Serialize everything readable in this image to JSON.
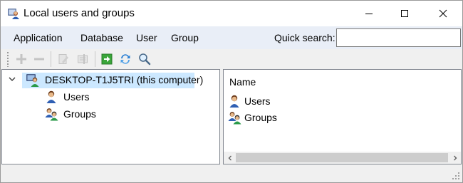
{
  "window": {
    "title": "Local users and groups"
  },
  "menu": {
    "items": [
      "Application",
      "Database",
      "User",
      "Group"
    ]
  },
  "search": {
    "label": "Quick search:",
    "value": "",
    "placeholder": ""
  },
  "toolbar": {
    "buttons": [
      {
        "icon": "plus-icon",
        "enabled": false
      },
      {
        "icon": "minus-icon",
        "enabled": false
      },
      {
        "icon": "edit-icon",
        "enabled": false
      },
      {
        "icon": "properties-icon",
        "enabled": false
      },
      {
        "icon": "export-icon",
        "enabled": true
      },
      {
        "icon": "refresh-icon",
        "enabled": true
      },
      {
        "icon": "search-icon",
        "enabled": true
      }
    ]
  },
  "tree": {
    "root": {
      "label": "DESKTOP-T1J5TRI (this computer)",
      "icon": "computer-users-icon",
      "expanded": true,
      "selected": true
    },
    "children": [
      {
        "label": "Users",
        "icon": "user-icon"
      },
      {
        "label": "Groups",
        "icon": "group-icon"
      }
    ]
  },
  "list": {
    "column": "Name",
    "items": [
      {
        "label": "Users",
        "icon": "user-icon"
      },
      {
        "label": "Groups",
        "icon": "group-icon"
      }
    ]
  },
  "colors": {
    "menubar": "#e9eef7",
    "selection": "#cce8ff",
    "disabled_icon": "#bdbdbd",
    "accent_green": "#3aa63a",
    "accent_blue": "#2a7fd4"
  }
}
